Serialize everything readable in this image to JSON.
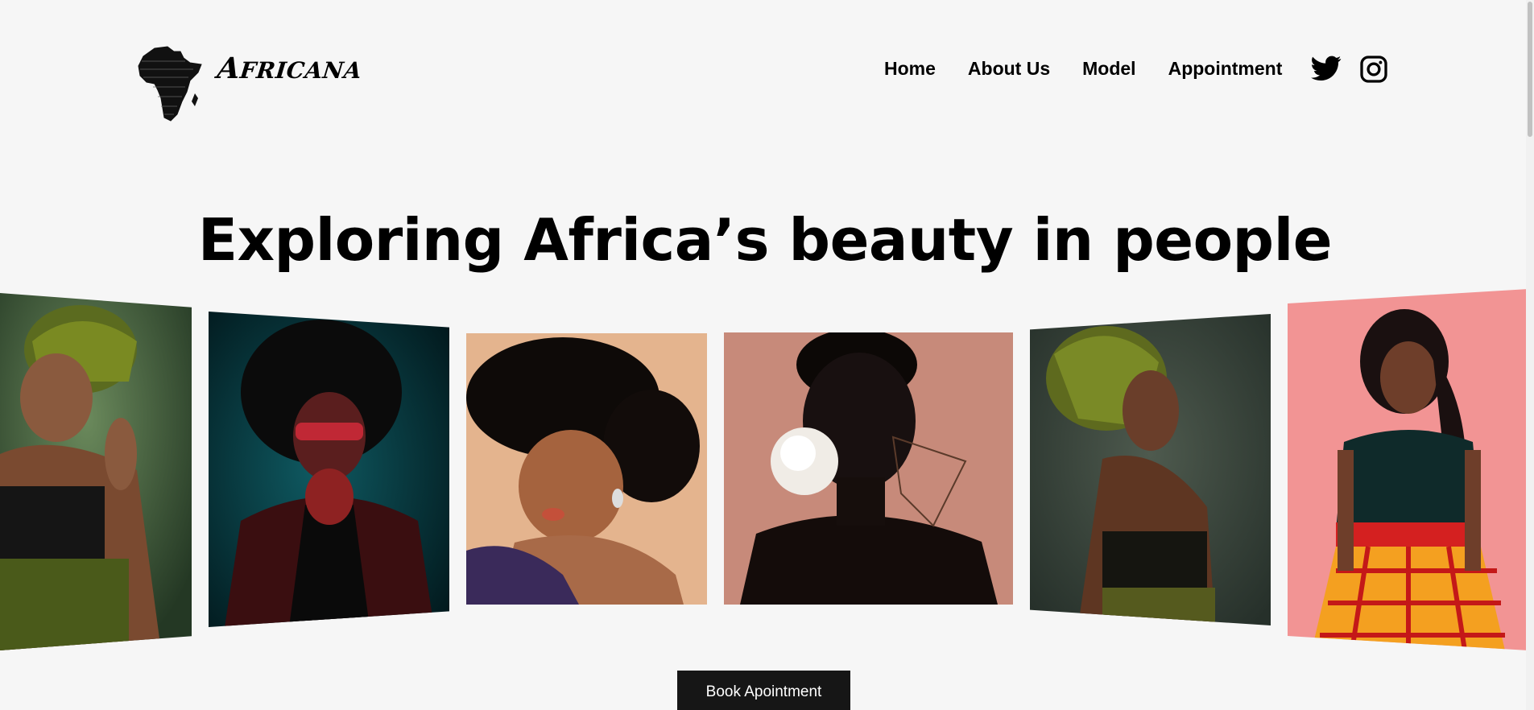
{
  "brand": {
    "name_first": "A",
    "name_rest": "FRICANA",
    "logo_icon": "africa-map-icon"
  },
  "nav": {
    "items": [
      {
        "label": "Home"
      },
      {
        "label": "About Us"
      },
      {
        "label": "Model"
      },
      {
        "label": "Appointment"
      }
    ],
    "social": [
      {
        "icon": "twitter-icon"
      },
      {
        "icon": "instagram-icon"
      }
    ]
  },
  "hero": {
    "headline": "Exploring Africa’s beauty in people"
  },
  "gallery": {
    "photos": [
      {
        "subject": "woman-green-headwrap-smiling",
        "bg": "#3c5a3c"
      },
      {
        "subject": "woman-afro-red-sunglasses",
        "bg": "#0c3a42"
      },
      {
        "subject": "woman-afro-eyes-closed",
        "bg": "#e2b08c"
      },
      {
        "subject": "woman-white-flower-portrait",
        "bg": "#c98a7a"
      },
      {
        "subject": "woman-headwrap-profile",
        "bg": "#3e4a40"
      },
      {
        "subject": "woman-pink-wall-skirt",
        "bg": "#f29090"
      }
    ]
  },
  "cta": {
    "label": "Book Apointment"
  },
  "colors": {
    "background": "#f6f6f6",
    "text": "#000000",
    "button_bg": "#161616",
    "button_text": "#ffffff"
  }
}
